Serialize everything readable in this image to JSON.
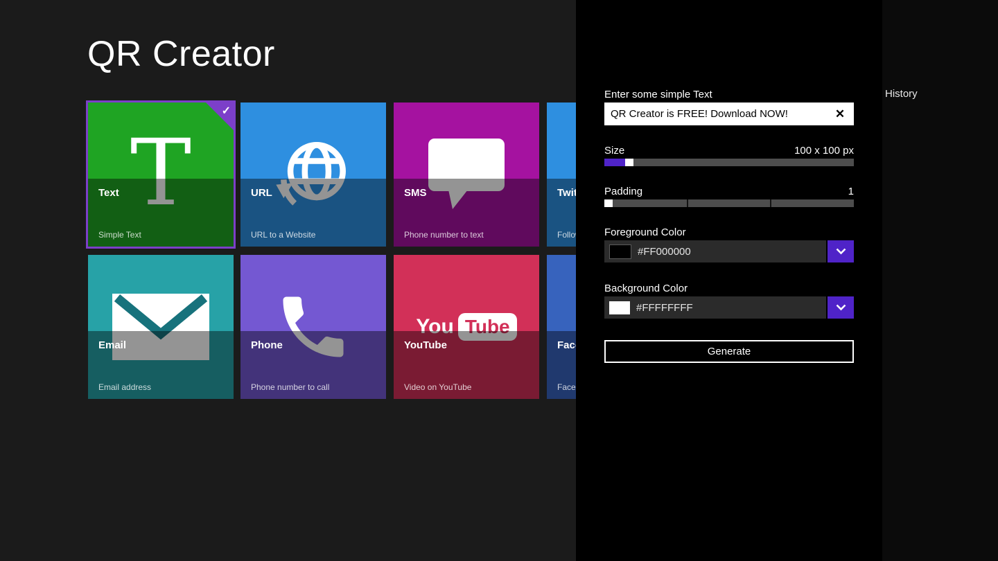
{
  "app": {
    "title": "QR Creator"
  },
  "history_label": "History",
  "icons": {
    "check": "✓",
    "clear": "✕"
  },
  "tiles": [
    {
      "id": "text",
      "label": "Text",
      "sublabel": "Simple Text",
      "color_top": "#1fa423",
      "selected": true,
      "icon": "letter-t-icon"
    },
    {
      "id": "url",
      "label": "URL",
      "sublabel": "URL to a Website",
      "color_top": "#2e8fe0",
      "selected": false,
      "icon": "globe-arrow-icon"
    },
    {
      "id": "sms",
      "label": "SMS",
      "sublabel": "Phone number to text",
      "color_top": "#a512a0",
      "selected": false,
      "icon": "speech-bubble-icon"
    },
    {
      "id": "twitter",
      "label": "Twitter",
      "sublabel": "Follow",
      "color_top": "#2e8fe0",
      "selected": false,
      "icon": "twitter-icon"
    },
    {
      "id": "email",
      "label": "Email",
      "sublabel": "Email address",
      "color_top": "#27a2a7",
      "selected": false,
      "icon": "envelope-icon"
    },
    {
      "id": "phone",
      "label": "Phone",
      "sublabel": "Phone number to call",
      "color_top": "#7458d2",
      "selected": false,
      "icon": "phone-handset-icon"
    },
    {
      "id": "youtube",
      "label": "YouTube",
      "sublabel": "Video on YouTube",
      "color_top": "#d23058",
      "selected": false,
      "icon": "youtube-logo-icon",
      "logo_you": "You",
      "logo_tube": "Tube"
    },
    {
      "id": "facebook",
      "label": "Facebook",
      "sublabel": "Facebook",
      "color_top": "#3763bd",
      "selected": false,
      "icon": "facebook-icon"
    }
  ],
  "panel": {
    "text_label": "Enter some simple Text",
    "text_value": "QR Creator is FREE! Download NOW!",
    "size_label": "Size",
    "size_value": "100 x 100 px",
    "padding_label": "Padding",
    "padding_value": "1",
    "foreground_label": "Foreground Color",
    "foreground_value": "#FF000000",
    "foreground_swatch": "#000000",
    "background_label": "Background Color",
    "background_value": "#FFFFFFFF",
    "background_swatch": "#FFFFFF",
    "generate_label": "Generate",
    "accent_color": "#4f23c8"
  }
}
